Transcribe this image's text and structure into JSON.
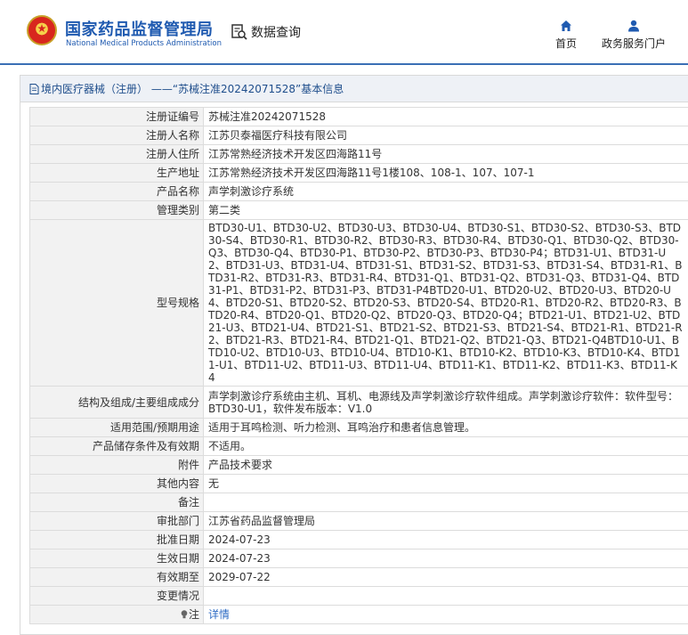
{
  "header": {
    "logo_cn": "国家药品监督管理局",
    "logo_en": "National Medical Products Administration",
    "data_query": "数据查询",
    "nav": {
      "home": "首页",
      "portal": "政务服务门户"
    }
  },
  "colors": {
    "brand_blue": "#1f5ab0",
    "link_blue": "#2f6cc4",
    "key_bg": "#f2f2f2"
  },
  "icons": {
    "emblem": "national-emblem-icon",
    "query": "document-search-icon",
    "home": "home-icon",
    "portal": "user-icon",
    "title": "document-icon",
    "note": "lightbulb-icon"
  },
  "panel": {
    "title": "境内医疗器械（注册） ——“苏械注准20242071528”基本信息"
  },
  "rows": [
    {
      "key": "注册证编号",
      "value": "苏械注准20242071528"
    },
    {
      "key": "注册人名称",
      "value": "江苏贝泰福医疗科技有限公司"
    },
    {
      "key": "注册人住所",
      "value": "江苏常熟经济技术开发区四海路11号"
    },
    {
      "key": "生产地址",
      "value": "江苏常熟经济技术开发区四海路11号1楼108、108-1、107、107-1"
    },
    {
      "key": "产品名称",
      "value": "声学刺激诊疗系统"
    },
    {
      "key": "管理类别",
      "value": "第二类"
    },
    {
      "key": "型号规格",
      "value": "BTD30-U1、BTD30-U2、BTD30-U3、BTD30-U4、BTD30-S1、BTD30-S2、BTD30-S3、BTD30-S4、BTD30-R1、BTD30-R2、BTD30-R3、BTD30-R4、BTD30-Q1、BTD30-Q2、BTD30-Q3、BTD30-Q4、BTD30-P1、BTD30-P2、BTD30-P3、BTD30-P4；BTD31-U1、BTD31-U2、BTD31-U3、BTD31-U4、BTD31-S1、BTD31-S2、BTD31-S3、BTD31-S4、BTD31-R1、BTD31-R2、BTD31-R3、BTD31-R4、BTD31-Q1、BTD31-Q2、BTD31-Q3、BTD31-Q4、BTD31-P1、BTD31-P2、BTD31-P3、BTD31-P4BTD20-U1、BTD20-U2、BTD20-U3、BTD20-U4、BTD20-S1、BTD20-S2、BTD20-S3、BTD20-S4、BTD20-R1、BTD20-R2、BTD20-R3、BTD20-R4、BTD20-Q1、BTD20-Q2、BTD20-Q3、BTD20-Q4；BTD21-U1、BTD21-U2、BTD21-U3、BTD21-U4、BTD21-S1、BTD21-S2、BTD21-S3、BTD21-S4、BTD21-R1、BTD21-R2、BTD21-R3、BTD21-R4、BTD21-Q1、BTD21-Q2、BTD21-Q3、BTD21-Q4BTD10-U1、BTD10-U2、BTD10-U3、BTD10-U4、BTD10-K1、BTD10-K2、BTD10-K3、BTD10-K4、BTD11-U1、BTD11-U2、BTD11-U3、BTD11-U4、BTD11-K1、BTD11-K2、BTD11-K3、BTD11-K4"
    },
    {
      "key": "结构及组成/主要组成成分",
      "value": "声学刺激诊疗系统由主机、耳机、电源线及声学刺激诊疗软件组成。声学刺激诊疗软件：软件型号：BTD30-U1，软件发布版本：V1.0"
    },
    {
      "key": "适用范围/预期用途",
      "value": "适用于耳鸣检测、听力检测、耳鸣治疗和患者信息管理。"
    },
    {
      "key": "产品储存条件及有效期",
      "value": "不适用。"
    },
    {
      "key": "附件",
      "value": "产品技术要求"
    },
    {
      "key": "其他内容",
      "value": "无"
    },
    {
      "key": "备注",
      "value": ""
    },
    {
      "key": "审批部门",
      "value": "江苏省药品监督管理局"
    },
    {
      "key": "批准日期",
      "value": "2024-07-23"
    },
    {
      "key": "生效日期",
      "value": "2024-07-23"
    },
    {
      "key": "有效期至",
      "value": "2029-07-22"
    },
    {
      "key": "变更情况",
      "value": ""
    }
  ],
  "note_row": {
    "key": "注",
    "link": "详情"
  }
}
